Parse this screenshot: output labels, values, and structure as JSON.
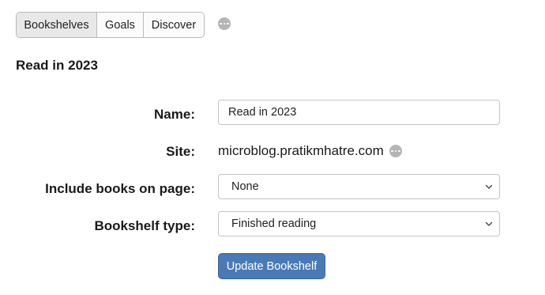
{
  "tabs": [
    {
      "label": "Bookshelves",
      "active": true
    },
    {
      "label": "Goals",
      "active": false
    },
    {
      "label": "Discover",
      "active": false
    }
  ],
  "page_title": "Read in 2023",
  "form": {
    "name": {
      "label": "Name:",
      "value": "Read in 2023"
    },
    "site": {
      "label": "Site:",
      "value": "microblog.pratikmhatre.com"
    },
    "include_books": {
      "label": "Include books on page:",
      "selected": "None"
    },
    "bookshelf_type": {
      "label": "Bookshelf type:",
      "selected": "Finished reading"
    },
    "submit_label": "Update Bookshelf"
  },
  "colors": {
    "primary_button": "#4a7ab6",
    "active_tab": "#e8e8e8",
    "more_icon": "#b5b5b5"
  },
  "icons": [
    "ellipsis-icon",
    "chevron-down-icon"
  ]
}
